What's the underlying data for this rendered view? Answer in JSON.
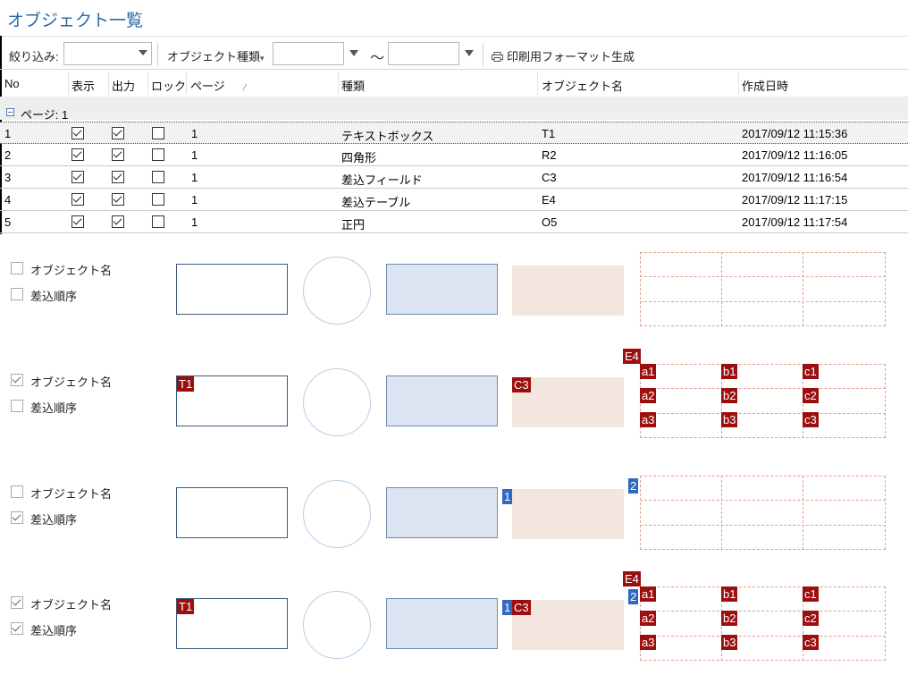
{
  "title": "オブジェクト一覧",
  "toolbar": {
    "filter_label": "絞り込み:",
    "filter_value": "",
    "object_type_label": "オブジェクト種類",
    "from_value": "",
    "tilde": "～",
    "to_value": "",
    "print_format_label": "印刷用フォーマット生成"
  },
  "grid": {
    "columns": [
      "No",
      "表示",
      "出力",
      "ロック",
      "ページ",
      "種類",
      "オブジェクト名",
      "作成日時"
    ],
    "sort_glyph": "⁄",
    "group_label": "ページ: 1",
    "rows": [
      {
        "no": "1",
        "show": true,
        "output": true,
        "lock": false,
        "page": "1",
        "type": "テキストボックス",
        "name": "T1",
        "created": "2017/09/12 11:15:36",
        "selected": true
      },
      {
        "no": "2",
        "show": true,
        "output": true,
        "lock": false,
        "page": "1",
        "type": "四角形",
        "name": "R2",
        "created": "2017/09/12 11:16:05",
        "selected": false
      },
      {
        "no": "3",
        "show": true,
        "output": true,
        "lock": false,
        "page": "1",
        "type": "差込フィールド",
        "name": "C3",
        "created": "2017/09/12 11:16:54",
        "selected": false
      },
      {
        "no": "4",
        "show": true,
        "output": true,
        "lock": false,
        "page": "1",
        "type": "差込テーブル",
        "name": "E4",
        "created": "2017/09/12 11:17:15",
        "selected": false
      },
      {
        "no": "5",
        "show": true,
        "output": true,
        "lock": false,
        "page": "1",
        "type": "正円",
        "name": "O5",
        "created": "2017/09/12 11:17:54",
        "selected": false
      }
    ]
  },
  "preview": {
    "option_object_name": "オブジェクト名",
    "option_merge_order": "差込順序",
    "panels": [
      {
        "object_name": false,
        "merge_order": false
      },
      {
        "object_name": true,
        "merge_order": false
      },
      {
        "object_name": false,
        "merge_order": true
      },
      {
        "object_name": true,
        "merge_order": true
      }
    ],
    "tags": {
      "text_box": "T1",
      "field": "C3",
      "table": "E4",
      "order_field": "1",
      "order_table": "2",
      "cells": [
        "a1",
        "b1",
        "c1",
        "a2",
        "b2",
        "c2",
        "a3",
        "b3",
        "c3"
      ]
    }
  },
  "colors": {
    "title": "#2a6aa6",
    "tag_red": "#9c0f0f",
    "tag_blue": "#2f6ac0",
    "field_fill": "#dbe4f0",
    "table_fill": "#f2e6df"
  }
}
